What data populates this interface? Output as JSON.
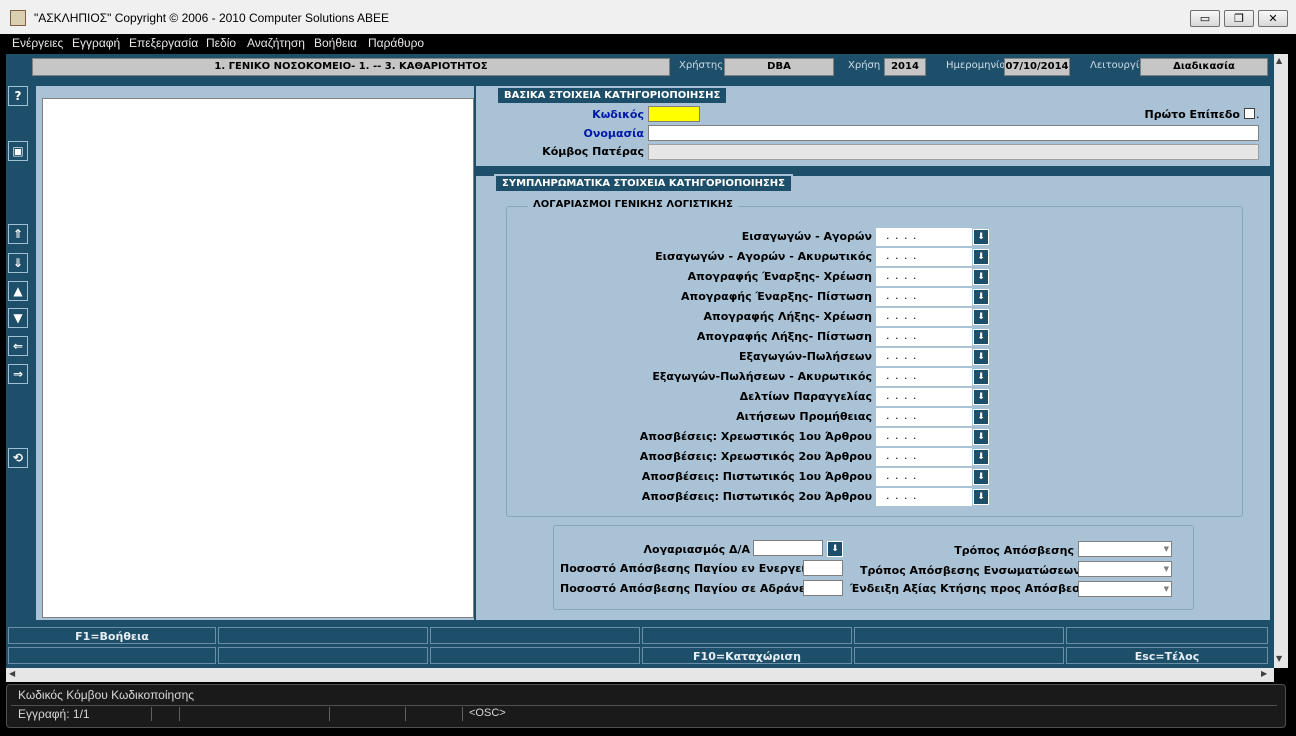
{
  "window": {
    "title": "\"ΑΣΚΛΗΠΙΟΣ\" Copyright © 2006 - 2010 Computer Solutions ABEE",
    "minimize": "▭",
    "restore": "❐",
    "close": "✕"
  },
  "menu": [
    "Ενέργειες",
    "Εγγραφή",
    "Επεξεργασία",
    "Πεδίο",
    "Αναζήτηση",
    "Βοήθεια",
    "Παράθυρο"
  ],
  "header": {
    "hospital": "1. ΓΕΝΙΚΟ ΝΟΣΟΚΟΜΕΙΟ- 1. -- 3. ΚΑΘΑΡΙΟΤΗΤΟΣ",
    "user_label": "Χρήστης",
    "user_value": "DBA",
    "year_label": "Χρήση",
    "year_value": "2014",
    "date_label": "Ημερομηνία",
    "date_value": "07/10/2014",
    "mode_label": "Λειτουργία",
    "mode_value": "Διαδικασία"
  },
  "toolbar": {
    "help": "?",
    "save": "▣",
    "first": "⇑",
    "last": "⇓",
    "prev": "▲",
    "next": "▼",
    "left": "⇐",
    "right": "⇒",
    "undo": "⟲"
  },
  "basic": {
    "title": "ΒΑΣΙΚΑ ΣΤΟΙΧΕΙΑ ΚΑΤΗΓΟΡΙΟΠΟΙΗΣΗΣ",
    "code_label": "Κωδικός",
    "name_label": "Ονομασία",
    "parent_label": "Κόμβος Πατέρας",
    "first_level_label": "Πρώτο Επίπεδο",
    "first_level_suffix": "."
  },
  "supplementary": {
    "title": "ΣΥΜΠΛΗΡΩΜΑΤΙΚΑ ΣΤΟΙΧΕΙΑ ΚΑΤΗΓΟΡΙΟΠΟΙΗΣΗΣ",
    "group_title": "ΛΟΓΑΡΙΑΣΜΟΙ ΓΕΝΙΚΗΣ ΛΟΓΙΣΤΙΚΗΣ",
    "account_placeholder": ". . . .",
    "lov_icon": "⬇",
    "accounts": [
      "Εισαγωγών - Αγορών",
      "Εισαγωγών - Αγορών  - Ακυρωτικός",
      "Απογραφής Έναρξης- Χρέωση",
      "Απογραφής Έναρξης- Πίστωση",
      "Απογραφής Λήξης- Χρέωση",
      "Απογραφής Λήξης- Πίστωση",
      "Εξαγωγών-Πωλήσεων",
      "Εξαγωγών-Πωλήσεων - Ακυρωτικός",
      "Δελτίων Παραγγελίας",
      "Αιτήσεων Προμήθειας",
      "Αποσβέσεις: Χρεωστικός 1ου Άρθρου",
      "Αποσβέσεις: Χρεωστικός 2ου Άρθρου",
      "Αποσβέσεις: Πιστωτικός 1ου Άρθρου",
      "Αποσβέσεις: Πιστωτικός 2ου Άρθρου"
    ]
  },
  "depreciation": {
    "account_da_label": "Λογαριασμός Δ/Α",
    "pct_active_label": "Ποσοστό Απόσβεσης Παγίου εν Ενεργεία",
    "pct_idle_label": "Ποσοστό Απόσβεσης Παγίου σε Αδράνεια",
    "method_label": "Τρόπος Απόσβεσης",
    "method_incorp_label": "Τρόπος Απόσβεσης Ενσωματώσεων",
    "value_indicator_label": "Ένδειξη Αξίας Κτήσης προς Απόσβεση"
  },
  "fkeys_row1": [
    "F1=Βοήθεια",
    "",
    "",
    "",
    "",
    ""
  ],
  "fkeys_row2": [
    "",
    "",
    "",
    "F10=Καταχώριση",
    "",
    "Esc=Τέλος"
  ],
  "status": {
    "hint": "Κωδικός Κόμβου Κωδικοποίησης",
    "record": "Εγγραφή: 1/1",
    "mode": "<OSC>"
  },
  "colors": {
    "background": "#1e4f6a",
    "panel": "#a9c2d5",
    "required_field": "#ffff00",
    "label_blue": "#0018a8"
  }
}
